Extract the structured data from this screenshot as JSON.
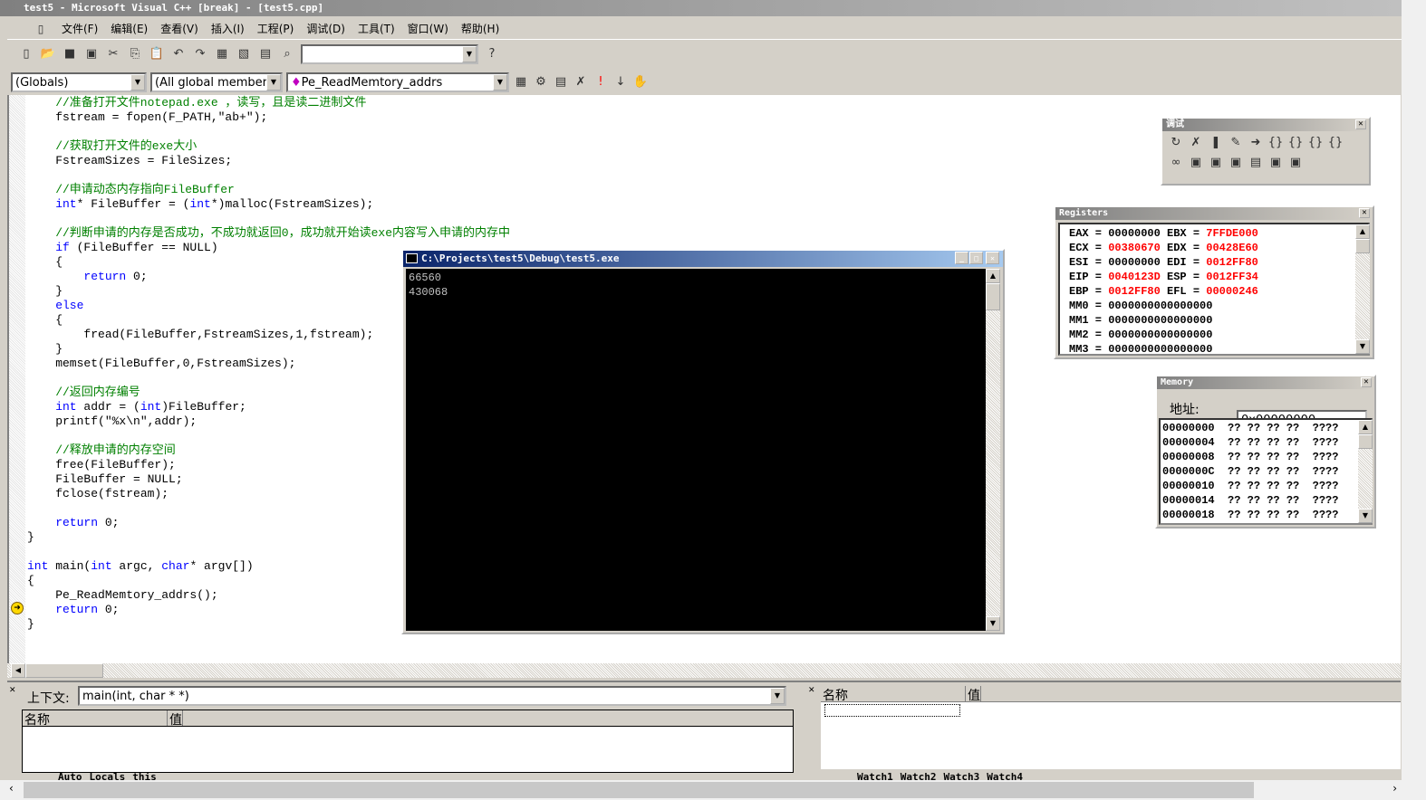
{
  "window": {
    "title": "test5 - Microsoft Visual C++ [break] - [test5.cpp]"
  },
  "menu": [
    "文件(F)",
    "编辑(E)",
    "查看(V)",
    "插入(I)",
    "工程(P)",
    "调试(D)",
    "工具(T)",
    "窗口(W)",
    "帮助(H)"
  ],
  "toolbar": {
    "icons": [
      "new-text-icon",
      "open-icon",
      "save-icon",
      "save-all-icon",
      "cut-icon",
      "copy-icon",
      "paste-icon",
      "undo-icon",
      "redo-icon",
      "workspace-icon",
      "output-icon",
      "window-list-icon",
      "find-in-files-icon"
    ],
    "find_value": ""
  },
  "wizardbar": {
    "scope": "(Globals)",
    "filter": "(All global members",
    "function": "Pe_ReadMemtory_addrs"
  },
  "code": [
    [
      [
        "cm",
        "    //准备打开文件notepad.exe ，读写，且是读二进制文件"
      ]
    ],
    [
      [
        "",
        "    fstream = fopen(F_PATH,\"ab+\");"
      ]
    ],
    [],
    [
      [
        "cm",
        "    //获取打开文件的exe大小"
      ]
    ],
    [
      [
        "",
        "    FstreamSizes = FileSizes;"
      ]
    ],
    [],
    [
      [
        "cm",
        "    //申请动态内存指向FileBuffer"
      ]
    ],
    [
      [
        "kw",
        "    int"
      ],
      [
        "",
        "* FileBuffer = ("
      ],
      [
        "kw",
        "int"
      ],
      [
        "",
        "*)malloc(FstreamSizes);"
      ]
    ],
    [],
    [
      [
        "cm",
        "    //判断申请的内存是否成功，不成功就返回0，成功就开始读exe内容写入申请的内存中"
      ]
    ],
    [
      [
        "kw",
        "    if"
      ],
      [
        "",
        " (FileBuffer == NULL)"
      ]
    ],
    [
      [
        "",
        "    {"
      ]
    ],
    [
      [
        "kw",
        "        return"
      ],
      [
        "",
        " 0;"
      ]
    ],
    [
      [
        "",
        "    }"
      ]
    ],
    [
      [
        "kw",
        "    else"
      ]
    ],
    [
      [
        "",
        "    {"
      ]
    ],
    [
      [
        "",
        "        fread(FileBuffer,FstreamSizes,1,fstream);"
      ]
    ],
    [
      [
        "",
        "    }"
      ]
    ],
    [
      [
        "",
        "    memset(FileBuffer,0,FstreamSizes);"
      ]
    ],
    [],
    [
      [
        "cm",
        "    //返回内存编号"
      ]
    ],
    [
      [
        "kw",
        "    int"
      ],
      [
        "",
        " addr = ("
      ],
      [
        "kw",
        "int"
      ],
      [
        "",
        ")FileBuffer;"
      ]
    ],
    [
      [
        "",
        "    printf(\"%x\\n\",addr);"
      ]
    ],
    [],
    [
      [
        "cm",
        "    //释放申请的内存空间"
      ]
    ],
    [
      [
        "",
        "    free(FileBuffer);"
      ]
    ],
    [
      [
        "",
        "    FileBuffer = NULL;"
      ]
    ],
    [
      [
        "",
        "    fclose(fstream);"
      ]
    ],
    [],
    [
      [
        "kw",
        "    return"
      ],
      [
        "",
        " 0;"
      ]
    ],
    [
      [
        "",
        "}"
      ]
    ],
    [],
    [
      [
        "kw",
        "int"
      ],
      [
        "",
        " main("
      ],
      [
        "kw",
        "int"
      ],
      [
        "",
        " argc, "
      ],
      [
        "kw",
        "char"
      ],
      [
        "",
        "* argv[])"
      ]
    ],
    [
      [
        "",
        "{"
      ]
    ],
    [
      [
        "",
        "    Pe_ReadMemtory_addrs();"
      ]
    ],
    [
      [
        "kw",
        "    return"
      ],
      [
        "",
        " 0;"
      ]
    ],
    [
      [
        "",
        "}"
      ]
    ]
  ],
  "console": {
    "title": "C:\\Projects\\test5\\Debug\\test5.exe",
    "output": "66560\n430068"
  },
  "debug_toolbar": {
    "title": "调试"
  },
  "registers": {
    "title": "Registers",
    "rows": [
      [
        {
          "n": "EAX",
          "v": "00000000",
          "c": false
        },
        {
          "n": "EBX",
          "v": "7FFDE000",
          "c": true
        }
      ],
      [
        {
          "n": "ECX",
          "v": "00380670",
          "c": true
        },
        {
          "n": "EDX",
          "v": "00428E60",
          "c": true
        }
      ],
      [
        {
          "n": "ESI",
          "v": "00000000",
          "c": false
        },
        {
          "n": "EDI",
          "v": "0012FF80",
          "c": true
        }
      ],
      [
        {
          "n": "EIP",
          "v": "0040123D",
          "c": true
        },
        {
          "n": "ESP",
          "v": "0012FF34",
          "c": true
        }
      ],
      [
        {
          "n": "EBP",
          "v": "0012FF80",
          "c": true
        },
        {
          "n": "EFL",
          "v": "00000246",
          "c": true
        }
      ],
      [
        {
          "n": "MM0",
          "v": "0000000000000000",
          "c": false
        }
      ],
      [
        {
          "n": "MM1",
          "v": "0000000000000000",
          "c": false
        }
      ],
      [
        {
          "n": "MM2",
          "v": "0000000000000000",
          "c": false
        }
      ],
      [
        {
          "n": "MM3",
          "v": "0000000000000000",
          "c": false
        }
      ]
    ]
  },
  "memory": {
    "title": "Memory",
    "address_label": "地址:",
    "address": "0x00000000",
    "rows": [
      "00000000  ?? ?? ?? ??  ????",
      "00000004  ?? ?? ?? ??  ????",
      "00000008  ?? ?? ?? ??  ????",
      "0000000C  ?? ?? ?? ??  ????",
      "00000010  ?? ?? ?? ??  ????",
      "00000014  ?? ?? ?? ??  ????",
      "00000018  ?? ?? ?? ??  ????"
    ]
  },
  "variables": {
    "context_label": "上下文:",
    "context": "main(int, char * *)",
    "col_name": "名称",
    "col_value": "值",
    "tabs": [
      "Auto",
      "Locals",
      "this"
    ]
  },
  "watch": {
    "col_name": "名称",
    "col_value": "值",
    "tabs": [
      "Watch1",
      "Watch2",
      "Watch3",
      "Watch4"
    ]
  },
  "colors": {
    "keyword": "#0000ff",
    "comment": "#008000",
    "changed_register": "#ff0000"
  }
}
